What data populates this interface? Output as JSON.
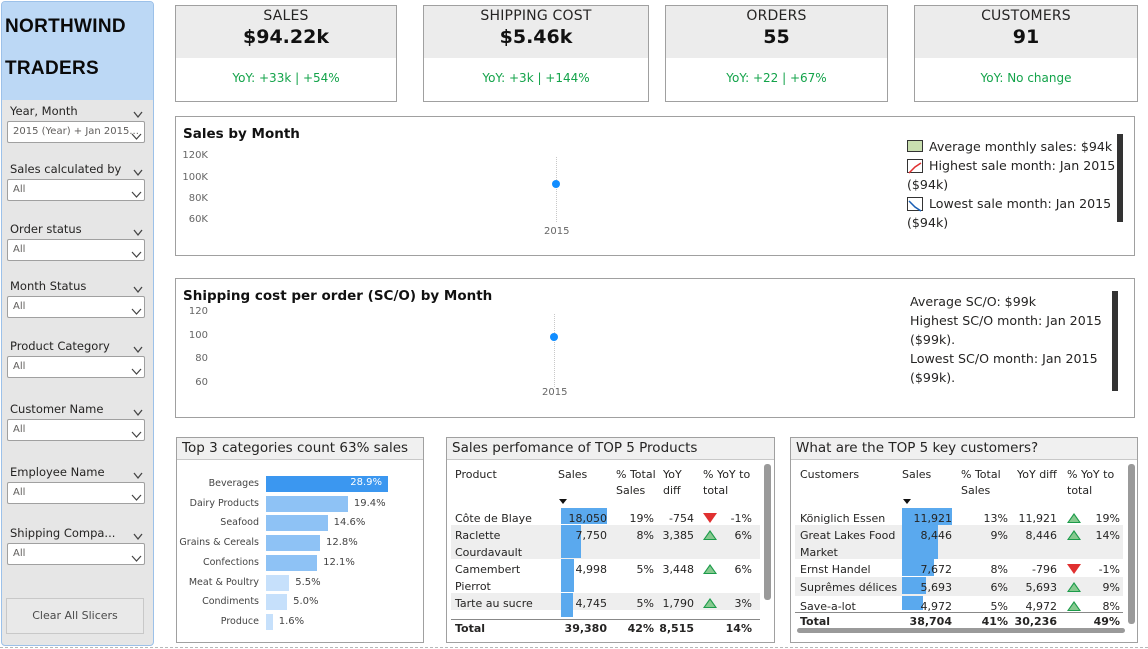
{
  "sidebar": {
    "logo_line1": "NORTHWIND",
    "logo_line2": "TRADERS",
    "slicers": [
      {
        "label": "Year, Month",
        "value": "2015 (Year) + Jan 2015..."
      },
      {
        "label": "Sales calculated by",
        "value": "All"
      },
      {
        "label": "Order status",
        "value": "All"
      },
      {
        "label": "Month Status",
        "value": "All"
      },
      {
        "label": "Product Category",
        "value": "All"
      },
      {
        "label": "Customer Name",
        "value": "All"
      },
      {
        "label": "Employee Name",
        "value": "All"
      },
      {
        "label": "Shipping Compa...",
        "value": "All"
      }
    ],
    "clear_button": "Clear All Slicers"
  },
  "kpis": [
    {
      "title": "SALES",
      "value": "$94.22k",
      "yoy": "YoY: +33k | +54%"
    },
    {
      "title": "SHIPPING COST",
      "value": "$5.46k",
      "yoy": "YoY: +3k | +144%"
    },
    {
      "title": "ORDERS",
      "value": "55",
      "yoy": "YoY: +22 | +67%"
    },
    {
      "title": "CUSTOMERS",
      "value": "91",
      "yoy": "YoY: No change"
    }
  ],
  "sales_by_month": {
    "title": "Sales by Month",
    "legend": [
      "Average monthly sales: $94k",
      "Highest sale month: Jan 2015",
      "($94k)",
      "Lowest sale month: Jan 2015",
      "($94k)"
    ]
  },
  "shipping_per_order": {
    "title": "Shipping cost per order (SC/O) by Month",
    "legend": [
      "Average SC/O: $99k",
      "Highest SC/O month: Jan 2015",
      "($99k).",
      "Lowest SC/O month: Jan 2015",
      "($99k)."
    ]
  },
  "chart_data": [
    {
      "type": "scatter",
      "title": "Sales by Month",
      "x": [
        "2015"
      ],
      "y": [
        94
      ],
      "yticks": [
        "120K",
        "100K",
        "80K",
        "60K"
      ],
      "ylim": [
        60,
        120
      ],
      "xticks": [
        "2015"
      ]
    },
    {
      "type": "scatter",
      "title": "Shipping cost per order (SC/O) by Month",
      "x": [
        "2015"
      ],
      "y": [
        99
      ],
      "yticks": [
        "120",
        "100",
        "80",
        "60"
      ],
      "ylim": [
        60,
        120
      ],
      "xticks": [
        "2015"
      ]
    },
    {
      "type": "bar",
      "title": "Top 3 categories count 63% sales",
      "categories": [
        "Beverages",
        "Dairy Products",
        "Seafood",
        "Grains & Cereals",
        "Confections",
        "Meat & Poultry",
        "Condiments",
        "Produce"
      ],
      "values": [
        28.9,
        19.4,
        14.6,
        12.8,
        12.1,
        5.5,
        5.0,
        1.6
      ],
      "labels": [
        "28.9%",
        "19.4%",
        "14.6%",
        "12.8%",
        "12.1%",
        "5.5%",
        "5.0%",
        "1.6%"
      ]
    }
  ],
  "top_products": {
    "title": "Sales perfomance of TOP 5 Products",
    "headers": [
      "Product",
      "Sales",
      "% Total Sales",
      "YoY diff",
      "% YoY to total"
    ],
    "header_lines": [
      [
        "Product"
      ],
      [
        "Sales"
      ],
      [
        "% Total",
        "Sales"
      ],
      [
        "YoY",
        "diff"
      ],
      [
        "% YoY to",
        "total"
      ]
    ],
    "rows": [
      {
        "name": [
          "Côte de Blaye"
        ],
        "sales": "18,050",
        "share": 1.0,
        "pct": "19%",
        "diff": "-754",
        "dir": "down",
        "yoy": "-1%"
      },
      {
        "name": [
          "Raclette",
          "Courdavault"
        ],
        "sales": "7,750",
        "share": 0.43,
        "pct": "8%",
        "diff": "3,385",
        "dir": "up",
        "yoy": "6%"
      },
      {
        "name": [
          "Camembert",
          "Pierrot"
        ],
        "sales": "4,998",
        "share": 0.28,
        "pct": "5%",
        "diff": "3,448",
        "dir": "up",
        "yoy": "6%"
      },
      {
        "name": [
          "Tarte au sucre"
        ],
        "sales": "4,745",
        "share": 0.26,
        "pct": "5%",
        "diff": "1,790",
        "dir": "up",
        "yoy": "3%"
      }
    ],
    "total": {
      "label": "Total",
      "sales": "39,380",
      "pct": "42%",
      "diff": "8,515",
      "yoy": "14%"
    }
  },
  "top_customers": {
    "title": "What are the TOP 5 key customers?",
    "headers": [
      "Customers",
      "Sales",
      "% Total Sales",
      "YoY diff",
      "% YoY to total"
    ],
    "header_lines": [
      [
        "Customers"
      ],
      [
        "Sales"
      ],
      [
        "% Total",
        "Sales"
      ],
      [
        "YoY diff"
      ],
      [
        "% YoY to",
        "total"
      ]
    ],
    "rows": [
      {
        "name": [
          "Königlich Essen"
        ],
        "sales": "11,921",
        "share": 1.0,
        "pct": "13%",
        "diff": "11,921",
        "dir": "up",
        "yoy": "19%"
      },
      {
        "name": [
          "Great Lakes Food",
          "Market"
        ],
        "sales": "8,446",
        "share": 0.71,
        "pct": "9%",
        "diff": "8,446",
        "dir": "up",
        "yoy": "14%"
      },
      {
        "name": [
          "Ernst Handel"
        ],
        "sales": "7,672",
        "share": 0.64,
        "pct": "8%",
        "diff": "-796",
        "dir": "down",
        "yoy": "-1%"
      },
      {
        "name": [
          "Suprêmes délices"
        ],
        "sales": "5,693",
        "share": 0.48,
        "pct": "6%",
        "diff": "5,693",
        "dir": "up",
        "yoy": "9%"
      },
      {
        "name": [
          "Save-a-lot"
        ],
        "sales": "4,972",
        "share": 0.42,
        "pct": "5%",
        "diff": "4,972",
        "dir": "up",
        "yoy": "8%"
      }
    ],
    "total": {
      "label": "Total",
      "sales": "38,704",
      "pct": "41%",
      "diff": "30,236",
      "yoy": "49%"
    }
  },
  "colors": {
    "accent": "#118dff",
    "positive": "#13a34a",
    "negative": "#e03030",
    "logo_bg": "#bcd8f5"
  }
}
